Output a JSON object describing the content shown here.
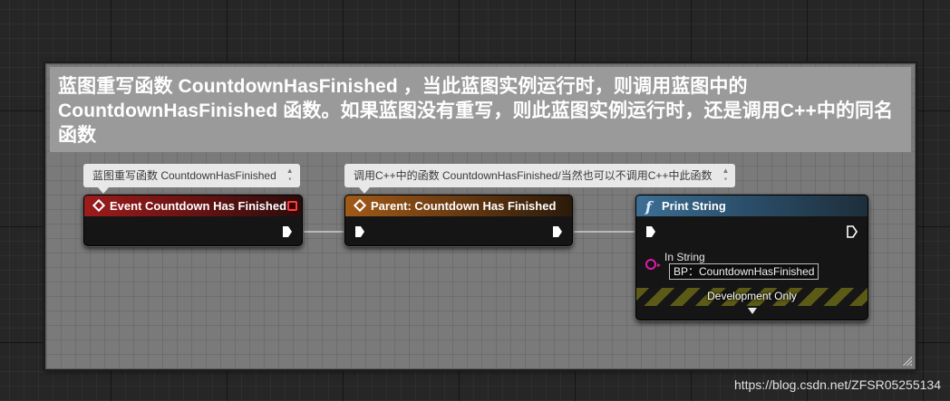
{
  "comment": {
    "text": "蓝图重写函数 CountdownHasFinished ，当此蓝图实例运行时，则调用蓝图中的 CountdownHasFinished 函数。如果蓝图没有重写，则此蓝图实例运行时，还是调用C++中的同名函数"
  },
  "bubbles": [
    {
      "text": "蓝图重写函数 CountdownHasFinished"
    },
    {
      "text": "调用C++中的函数 CountdownHasFinished/当然也可以不调用C++中此函数"
    }
  ],
  "nodes": {
    "event": {
      "title": "Event Countdown Has Finished",
      "color": "#9c1c1c",
      "icon": "event-icon"
    },
    "parent": {
      "title": "Parent: Countdown Has Finished",
      "color": "#a05a18",
      "icon": "event-icon"
    },
    "print": {
      "title": "Print String",
      "color": "#3c6f94",
      "icon": "function-icon",
      "in_string_label": "In String",
      "in_string_value": "BP：CountdownHasFinished",
      "dev_only_label": "Development Only"
    }
  },
  "colors": {
    "exec_wire": "#b8b8b8",
    "string_pin": "#e01aa8",
    "delegate_pin": "#ff3c3c"
  },
  "watermark": "https://blog.csdn.net/ZFSR05255134"
}
